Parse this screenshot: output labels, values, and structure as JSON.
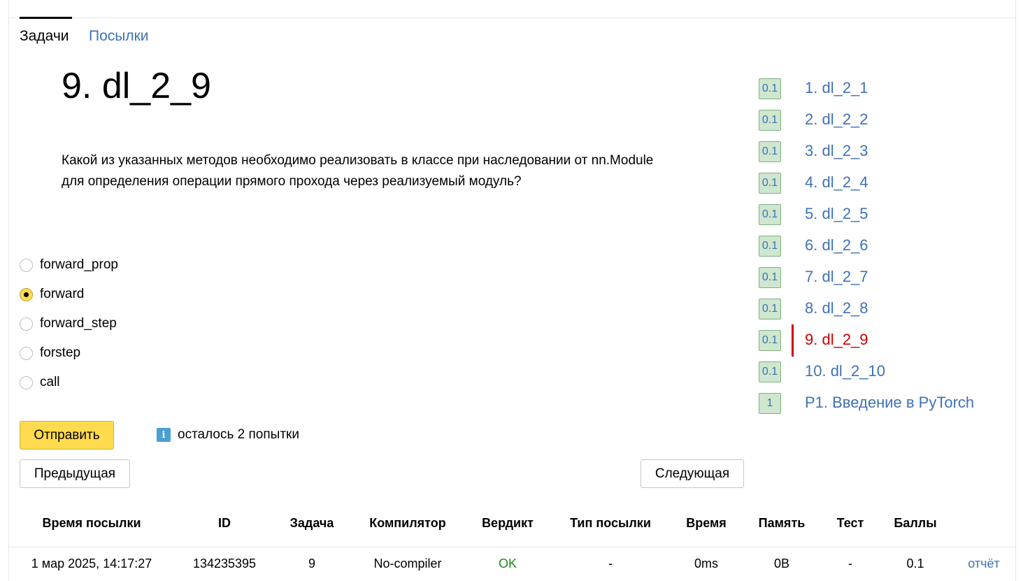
{
  "tabs": {
    "tasks": "Задачи",
    "submissions": "Посылки"
  },
  "problem": {
    "title": "9. dl_2_9",
    "statement_line1": "Какой из указанных методов необходимо реализовать в классе при наследовании от nn.Module",
    "statement_line2": "для определения операции прямого прохода через реализуемый модуль?"
  },
  "options": [
    {
      "label": "forward_prop",
      "checked": false
    },
    {
      "label": "forward",
      "checked": true
    },
    {
      "label": "forward_step",
      "checked": false
    },
    {
      "label": "forstep",
      "checked": false
    },
    {
      "label": "call",
      "checked": false
    }
  ],
  "buttons": {
    "submit": "Отправить",
    "prev": "Предыдущая",
    "next": "Следующая"
  },
  "attempts": {
    "icon": "i",
    "text": "осталось 2 попытки"
  },
  "problem_list": [
    {
      "score": "0.1",
      "label": "1. dl_2_1"
    },
    {
      "score": "0.1",
      "label": "2. dl_2_2"
    },
    {
      "score": "0.1",
      "label": "3. dl_2_3"
    },
    {
      "score": "0.1",
      "label": "4. dl_2_4"
    },
    {
      "score": "0.1",
      "label": "5. dl_2_5"
    },
    {
      "score": "0.1",
      "label": "6. dl_2_6"
    },
    {
      "score": "0.1",
      "label": "7. dl_2_7"
    },
    {
      "score": "0.1",
      "label": "8. dl_2_8"
    },
    {
      "score": "0.1",
      "label": "9. dl_2_9",
      "current": true
    },
    {
      "score": "0.1",
      "label": "10. dl_2_10"
    },
    {
      "score": "1",
      "label": "P1. Введение в PyTorch"
    }
  ],
  "table": {
    "headers": [
      "Время посылки",
      "ID",
      "Задача",
      "Компилятор",
      "Вердикт",
      "Тип посылки",
      "Время",
      "Память",
      "Тест",
      "Баллы"
    ],
    "row": [
      "1 мар 2025, 14:17:27",
      "134235395",
      "9",
      "No-compiler",
      "OK",
      "-",
      "0ms",
      "0B",
      "-",
      "0.1",
      "отчёт"
    ]
  },
  "colors": {
    "accent": "#ffdb4d",
    "link": "#3f72b7",
    "current": "#cc0000",
    "ok": "#1c8a1c"
  }
}
